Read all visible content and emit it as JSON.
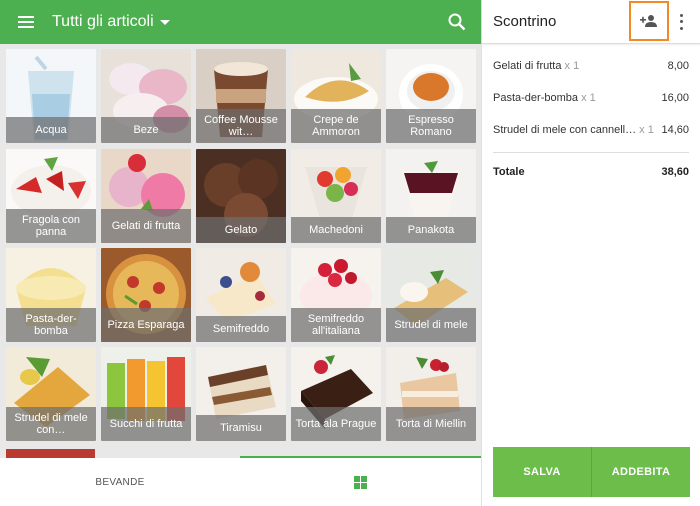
{
  "topbar": {
    "category_title": "Tutti gli articoli"
  },
  "items": [
    {
      "label": "Acqua"
    },
    {
      "label": "Beze"
    },
    {
      "label": "Coffee Mousse wit…"
    },
    {
      "label": "Crepe de Ammoron"
    },
    {
      "label": "Espresso Romano"
    },
    {
      "label": "Fragola con panna"
    },
    {
      "label": "Gelati di frutta"
    },
    {
      "label": "Gelato"
    },
    {
      "label": "Machedoni"
    },
    {
      "label": "Panakota"
    },
    {
      "label": "Pasta-der-bomba"
    },
    {
      "label": "Pizza Esparaga"
    },
    {
      "label": "Semifreddo"
    },
    {
      "label": "Semifreddo all'italiana"
    },
    {
      "label": "Strudel di mele"
    },
    {
      "label": "Strudel di mele con…"
    },
    {
      "label": "Succhi di frutta"
    },
    {
      "label": "Tiramisu"
    },
    {
      "label": "Torta ala Prague"
    },
    {
      "label": "Torta di Miellin"
    }
  ],
  "bottom_tabs": {
    "tab1_label": "BEVANDE"
  },
  "receipt": {
    "title": "Scontrino",
    "lines": [
      {
        "name": "Gelati di frutta",
        "qty": "x 1",
        "price": "8,00"
      },
      {
        "name": "Pasta-der-bomba",
        "qty": "x 1",
        "price": "16,00"
      },
      {
        "name": "Strudel di mele con cannell…",
        "qty": "x 1",
        "price": "14,60"
      }
    ],
    "total_label": "Totale",
    "total_value": "38,60",
    "save_label": "SALVA",
    "charge_label": "ADDEBITA"
  },
  "colors": {
    "primary": "#4caf50",
    "highlight": "#f08a24",
    "button": "#6cbd4a"
  }
}
